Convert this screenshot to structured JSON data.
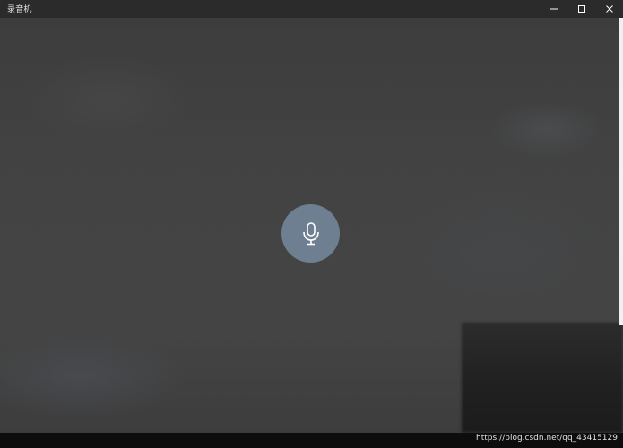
{
  "window": {
    "title": "录音机"
  },
  "titlebar": {
    "buttons": [
      {
        "name": "minimize",
        "icon": "minimize-icon"
      },
      {
        "name": "maximize",
        "icon": "maximize-icon"
      },
      {
        "name": "close",
        "icon": "close-icon"
      }
    ]
  },
  "main": {
    "record_button": {
      "icon": "microphone-icon",
      "color": "#6e7f91"
    }
  },
  "footer": {
    "watermark": "https://blog.csdn.net/qq_43415129"
  }
}
